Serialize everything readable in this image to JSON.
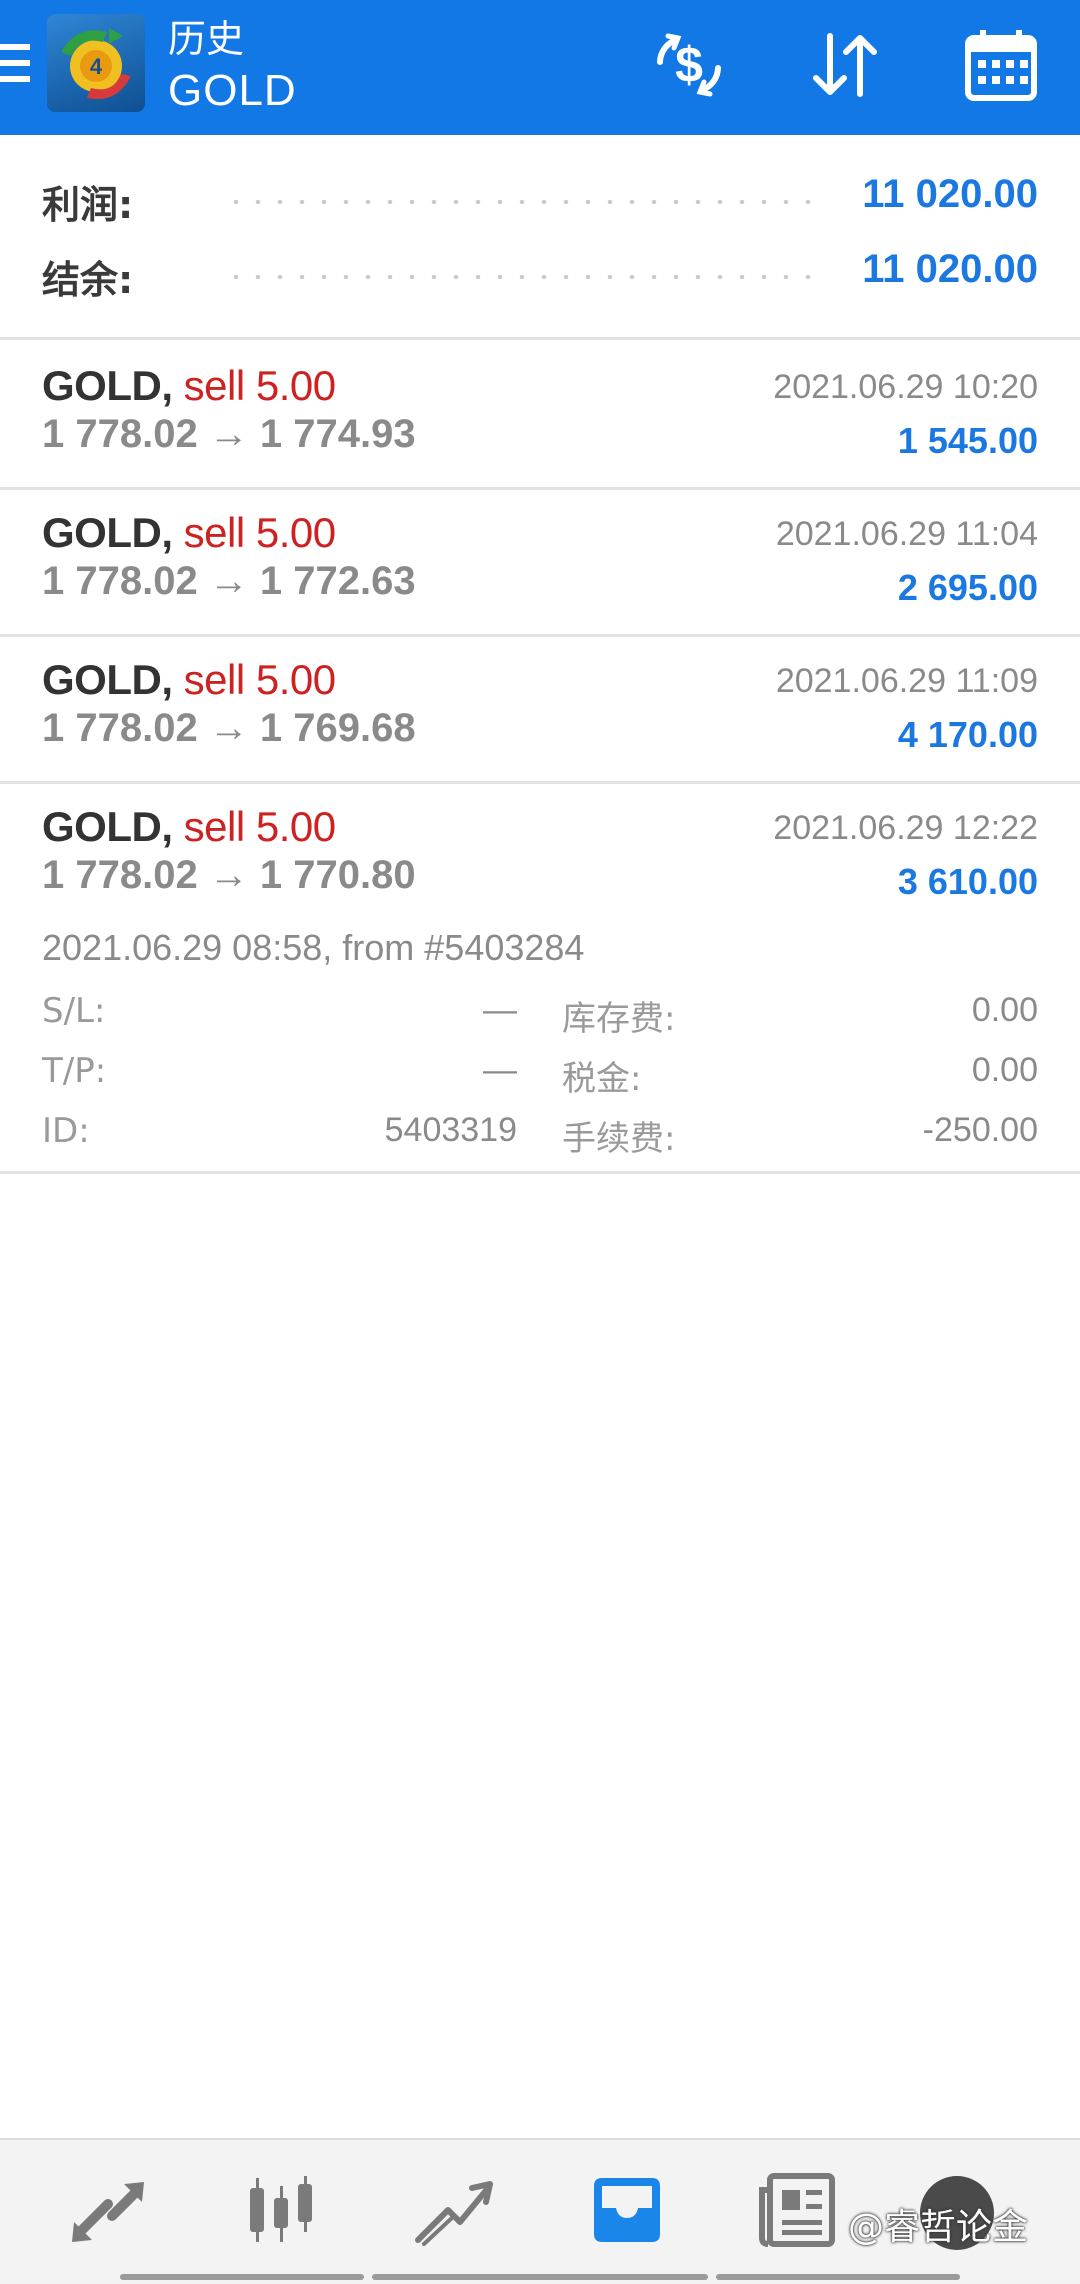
{
  "header": {
    "title": "历史",
    "symbol": "GOLD",
    "icons": [
      "menu-icon",
      "app-logo-icon",
      "currency-exchange-icon",
      "sort-icon",
      "calendar-icon"
    ]
  },
  "summary": {
    "profit_label": "利润:",
    "profit_value": "11 020.00",
    "balance_label": "结余:",
    "balance_value": "11 020.00"
  },
  "deals": [
    {
      "symbol": "GOLD,",
      "type": "sell",
      "volume": "5.00",
      "prices": "1 778.02 → 1 774.93",
      "time": "2021.06.29 10:20",
      "profit": "1 545.00"
    },
    {
      "symbol": "GOLD,",
      "type": "sell",
      "volume": "5.00",
      "prices": "1 778.02 → 1 772.63",
      "time": "2021.06.29 11:04",
      "profit": "2 695.00"
    },
    {
      "symbol": "GOLD,",
      "type": "sell",
      "volume": "5.00",
      "prices": "1 778.02 → 1 769.68",
      "time": "2021.06.29 11:09",
      "profit": "4 170.00"
    },
    {
      "symbol": "GOLD,",
      "type": "sell",
      "volume": "5.00",
      "prices": "1 778.02 → 1 770.80",
      "time": "2021.06.29 12:22",
      "profit": "3 610.00"
    }
  ],
  "expanded": {
    "open_info": "2021.06.29 08:58, from #5403284",
    "sl_label": "S/L:",
    "sl_value": "—",
    "tp_label": "T/P:",
    "tp_value": "—",
    "id_label": "ID:",
    "id_value": "5403319",
    "swap_label": "库存费:",
    "swap_value": "0.00",
    "tax_label": "税金:",
    "tax_value": "0.00",
    "commission_label": "手续费:",
    "commission_value": "-250.00"
  },
  "bottom_nav": {
    "items": [
      "quotes-icon",
      "chart-icon",
      "trade-icon",
      "history-icon",
      "news-icon",
      "messages-icon"
    ],
    "active": "history-icon"
  },
  "watermark": "@睿哲论金",
  "colors": {
    "header_bg": "#1178e6",
    "profit_blue": "#1a78e0",
    "sell_red": "#cc2222",
    "muted_gray": "#8a8a8a"
  }
}
